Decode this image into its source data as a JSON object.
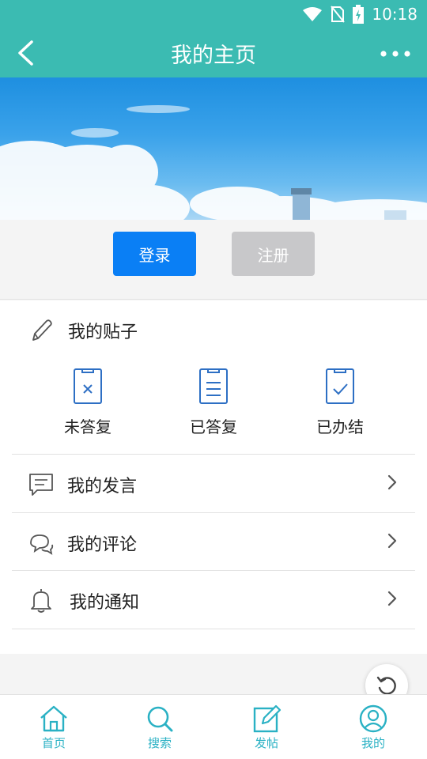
{
  "status_bar": {
    "time": "10:18",
    "icons": [
      "wifi-icon",
      "no-sim-icon",
      "battery-charging-icon"
    ]
  },
  "header": {
    "title": "我的主页",
    "back_icon": "back-arrow-icon",
    "more_icon": "more-dots-icon"
  },
  "auth": {
    "login_label": "登录",
    "register_label": "注册"
  },
  "posts": {
    "title": "我的贴子",
    "icon": "pencil-icon",
    "stats": [
      {
        "label": "未答复",
        "icon": "clipboard-x-icon"
      },
      {
        "label": "已答复",
        "icon": "clipboard-lines-icon"
      },
      {
        "label": "已办结",
        "icon": "clipboard-check-icon"
      }
    ]
  },
  "menu": [
    {
      "label": "我的发言",
      "icon": "speech-bubble-icon"
    },
    {
      "label": "我的评论",
      "icon": "chat-bubbles-icon"
    },
    {
      "label": "我的通知",
      "icon": "bell-icon"
    }
  ],
  "tabbar": [
    {
      "label": "首页",
      "icon": "home-icon"
    },
    {
      "label": "搜索",
      "icon": "search-icon"
    },
    {
      "label": "发帖",
      "icon": "compose-icon"
    },
    {
      "label": "我的",
      "icon": "profile-icon"
    }
  ],
  "colors": {
    "header": "#3bbbb2",
    "login": "#0a7ff5",
    "register": "#c8c8ca",
    "tab_accent": "#2ab1c4",
    "icon_blue": "#2d6fc4"
  }
}
